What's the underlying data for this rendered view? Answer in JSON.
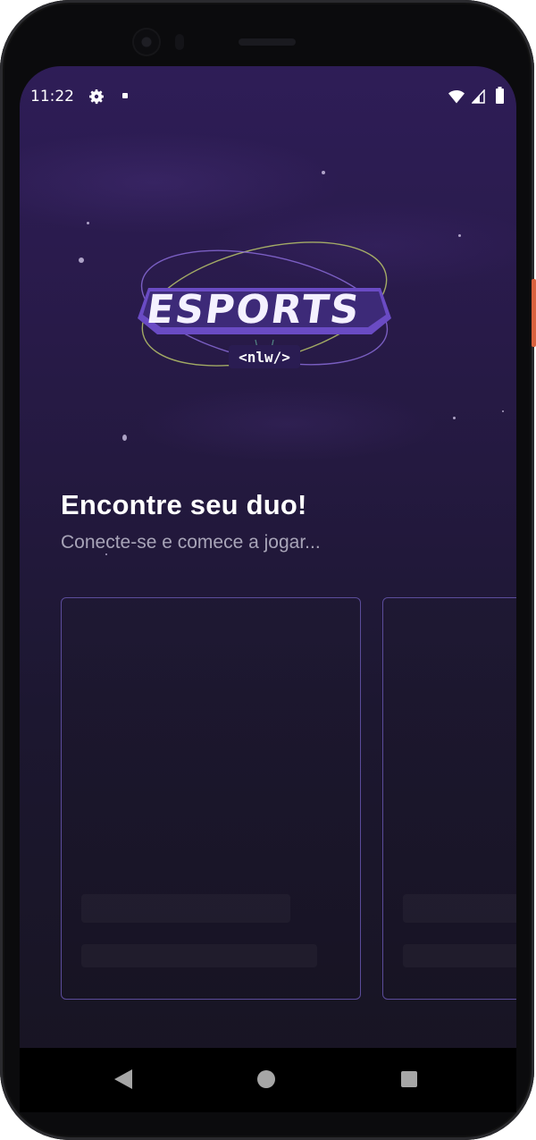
{
  "status_bar": {
    "time": "11:22",
    "icons": [
      "gear-icon",
      "notification-dot-icon",
      "wifi-icon",
      "signal-icon",
      "battery-icon"
    ]
  },
  "logo": {
    "name": "esports-nlw-logo",
    "wordmark": "ESPORTS",
    "tag": "<nlw/>"
  },
  "hero": {
    "title": "Encontre seu duo!",
    "subtitle": "Conecte-se e comece a jogar..."
  },
  "game_cards": [
    {
      "state": "loading"
    },
    {
      "state": "loading"
    }
  ],
  "nav_bar": {
    "icons": [
      "back-icon",
      "home-icon",
      "recents-icon"
    ]
  },
  "colors": {
    "background_top": "#2e1d57",
    "background_bottom": "#171421",
    "card_border": "#5b4c9a",
    "title": "#ffffff",
    "subtitle": "#a8a4b8",
    "accent_purple": "#8b5cf6"
  }
}
